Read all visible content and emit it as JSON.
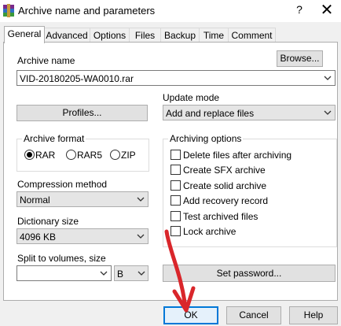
{
  "window": {
    "title": "Archive name and parameters",
    "help_icon": "?",
    "close_icon": "✕"
  },
  "tabs": [
    {
      "label": "General",
      "active": true
    },
    {
      "label": "Advanced"
    },
    {
      "label": "Options"
    },
    {
      "label": "Files"
    },
    {
      "label": "Backup"
    },
    {
      "label": "Time"
    },
    {
      "label": "Comment"
    }
  ],
  "archive_name": {
    "label": "Archive name",
    "value": "VID-20180205-WA0010.rar",
    "browse_label": "Browse..."
  },
  "profiles_label": "Profiles...",
  "update_mode": {
    "label": "Update mode",
    "value": "Add and replace files"
  },
  "archive_format": {
    "label": "Archive format",
    "options": [
      {
        "label": "RAR",
        "selected": true
      },
      {
        "label": "RAR5",
        "selected": false
      },
      {
        "label": "ZIP",
        "selected": false
      }
    ]
  },
  "archiving_options": {
    "label": "Archiving options",
    "items": [
      {
        "label": "Delete files after archiving",
        "checked": false
      },
      {
        "label": "Create SFX archive",
        "checked": false
      },
      {
        "label": "Create solid archive",
        "checked": false
      },
      {
        "label": "Add recovery record",
        "checked": false
      },
      {
        "label": "Test archived files",
        "checked": false
      },
      {
        "label": "Lock archive",
        "checked": false
      }
    ]
  },
  "compression_method": {
    "label": "Compression method",
    "value": "Normal"
  },
  "dictionary_size": {
    "label": "Dictionary size",
    "value": "4096 KB"
  },
  "split_volumes": {
    "label": "Split to volumes, size",
    "value": "",
    "unit": "B"
  },
  "set_password_label": "Set password...",
  "buttons": {
    "ok": "OK",
    "cancel": "Cancel",
    "help": "Help"
  },
  "colors": {
    "accent": "#0078d7",
    "annotation_arrow": "#d9262b"
  }
}
